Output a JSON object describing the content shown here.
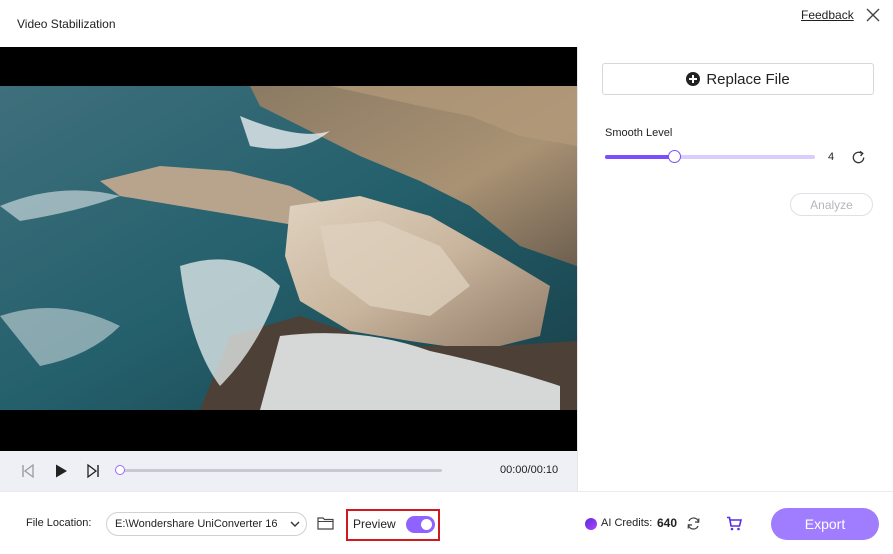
{
  "window": {
    "title": "Video Stabilization",
    "feedback_label": "Feedback",
    "close_icon": "close-icon"
  },
  "player": {
    "time_display": "00:00/00:10",
    "progress": 0,
    "icons": [
      "skip-to-start-icon",
      "play-icon",
      "next-frame-icon"
    ]
  },
  "panel": {
    "replace_label": "Replace File",
    "smooth_level_label": "Smooth Level",
    "smooth_level_value": "4",
    "smooth_level_fraction": 0.33,
    "analyze_label": "Analyze"
  },
  "bottom": {
    "file_location_label": "File Location:",
    "file_path": "E:\\Wondershare UniConverter 16",
    "preview_label": "Preview",
    "preview_on": true,
    "ai_credits_label": "AI Credits:",
    "ai_credits_value": "640",
    "export_label": "Export"
  },
  "colors": {
    "accent": "#7a4dff",
    "export_bg": "#a07cff",
    "highlight_border": "#d0191f"
  }
}
